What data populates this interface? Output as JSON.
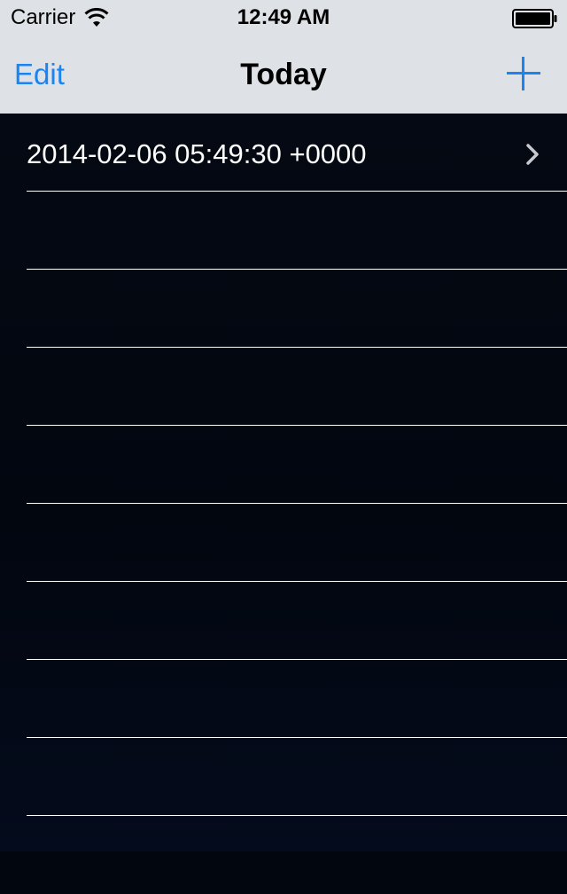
{
  "status_bar": {
    "carrier": "Carrier",
    "time": "12:49 AM"
  },
  "nav_bar": {
    "edit_label": "Edit",
    "title": "Today",
    "add_icon": "plus-icon"
  },
  "table": {
    "rows": [
      {
        "label": "2014-02-06 05:49:30 +0000",
        "accessory": "chevron-right-icon"
      },
      {
        "label": ""
      },
      {
        "label": ""
      },
      {
        "label": ""
      },
      {
        "label": ""
      },
      {
        "label": ""
      },
      {
        "label": ""
      },
      {
        "label": ""
      },
      {
        "label": ""
      },
      {
        "label": ""
      }
    ]
  },
  "colors": {
    "accent": "#1a84f2",
    "header_background": "#dee1e5",
    "table_background": "#02060f",
    "separator": "#ffffff"
  }
}
